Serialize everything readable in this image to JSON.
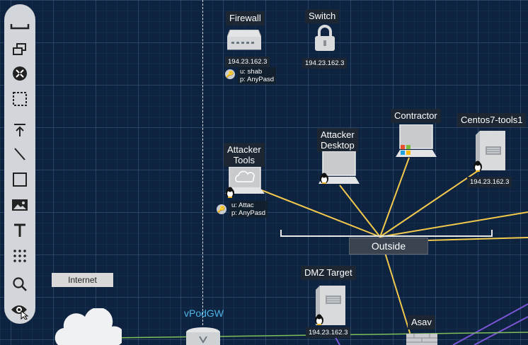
{
  "toolbar": {
    "tools": [
      {
        "name": "minimize-tool",
        "icon": "minimize-icon"
      },
      {
        "name": "windows-tool",
        "icon": "windows-icon"
      },
      {
        "name": "collapse-tool",
        "icon": "collapse-icon"
      },
      {
        "name": "select-tool",
        "icon": "marquee-select-icon"
      },
      {
        "name": "anchor-tool",
        "icon": "arrow-to-line-icon"
      },
      {
        "name": "line-tool",
        "icon": "line-icon"
      },
      {
        "name": "rectangle-tool",
        "icon": "rectangle-icon"
      },
      {
        "name": "image-tool",
        "icon": "image-icon"
      },
      {
        "name": "text-tool",
        "icon": "text-icon"
      },
      {
        "name": "grid-tool",
        "icon": "dot-grid-icon"
      },
      {
        "name": "search-tool",
        "icon": "search-icon"
      },
      {
        "name": "view-tool",
        "icon": "eye-icon"
      }
    ]
  },
  "nodes": {
    "firewall": {
      "label": "Firewall",
      "ip": "194.23.162.3",
      "user": "u: shab",
      "password": "p: AnyPasd"
    },
    "switch": {
      "label": "Switch",
      "ip": "194.23.162.3"
    },
    "attacker_tools": {
      "label_line1": "Attacker",
      "label_line2": "Tools",
      "user": "u: Attac",
      "password": "p: AnyPasd"
    },
    "attacker_desktop": {
      "label_line1": "Attacker",
      "label_line2": "Desktop"
    },
    "contractor": {
      "label": "Contractor"
    },
    "centos": {
      "label": "Centos7-tools1",
      "ip": "194.23.162.3"
    },
    "dmz_target": {
      "label": "DMZ Target",
      "ip": "194.23.162.3"
    },
    "asav": {
      "label": "Asav"
    },
    "vpodgw": {
      "label": "vPodGW"
    },
    "internet": {
      "label": "Internet"
    },
    "outside": {
      "label": "Outside"
    }
  },
  "colors": {
    "background": "#0d2340",
    "link": "#f2c94c",
    "link_purple": "#7a55d6",
    "link_green": "#7fbf5a",
    "vpodgw_label": "#4fb6e8",
    "toolbar": "#d2d5d9"
  }
}
